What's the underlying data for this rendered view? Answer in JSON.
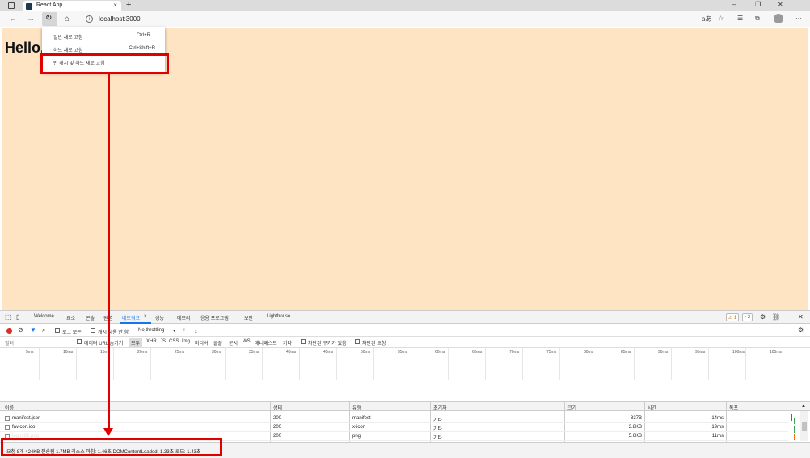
{
  "browser": {
    "tab_title": "React App",
    "tab_close": "×",
    "new_tab": "+",
    "window_controls": [
      "–",
      "❐",
      "✕"
    ],
    "url": "localhost:3000",
    "icons": [
      "back-icon",
      "forward-icon",
      "reload-icon",
      "home-icon",
      "info-icon",
      "read-aloud-icon",
      "favorite-icon",
      "favorites-icon",
      "collections-icon",
      "profile-icon",
      "more-icon"
    ]
  },
  "page": {
    "heading": "Hello,",
    "background": "#ffe4c4"
  },
  "context_menu": {
    "items": [
      {
        "label": "일반 새로 고침",
        "shortcut": "Ctrl+R"
      },
      {
        "label": "하드 새로 고침",
        "shortcut": "Ctrl+Shift+R"
      },
      {
        "label": "빈 캐시 및 하드 새로 고침",
        "shortcut": ""
      }
    ]
  },
  "annotation_color": "#e00000",
  "devtools": {
    "tabs": [
      "Welcome",
      "요소",
      "콘솔",
      "원본",
      "네트워크",
      "성능",
      "메모리",
      "응용 프로그램",
      "보안",
      "Lighthouse"
    ],
    "active_tab": "네트워크",
    "tab_close": "×",
    "warnings": "1",
    "messages": "2",
    "toolbar": {
      "preserve_log": "로그 보존",
      "disable_cache": "캐시 사용 안 함",
      "throttling": "No throttling"
    },
    "filter": {
      "placeholder": "필터",
      "hide_data_urls": "데이터 URL 숨기기",
      "types": [
        "모두",
        "XHR",
        "JS",
        "CSS",
        "Img",
        "미디어",
        "글꼴",
        "문서",
        "WS",
        "매니페스트",
        "기타"
      ],
      "blocked_cookies": "차단된 쿠키가 있음",
      "blocked_requests": "차단된 요청"
    },
    "timeline_ticks": [
      "5ms",
      "10ms",
      "15ms",
      "20ms",
      "25ms",
      "30ms",
      "35ms",
      "40ms",
      "45ms",
      "50ms",
      "55ms",
      "60ms",
      "65ms",
      "70ms",
      "75ms",
      "80ms",
      "85ms",
      "90ms",
      "95ms",
      "100ms",
      "105ms"
    ],
    "columns": [
      "이름",
      "상태",
      "유형",
      "초기자",
      "크기",
      "시간",
      "폭포"
    ],
    "rows": [
      {
        "name": "manifest.json",
        "status": "200",
        "type": "manifest",
        "initiator": "기타",
        "size": "837B",
        "time": "14ms"
      },
      {
        "name": "favicon.ico",
        "status": "200",
        "type": "x-icon",
        "initiator": "기타",
        "size": "3.8KB",
        "time": "19ms"
      },
      {
        "name": "logo192.png",
        "status": "200",
        "type": "png",
        "initiator": "기타",
        "size": "5.6KB",
        "time": "11ms"
      }
    ],
    "status": "요청 8개  424KB 전송됨  1.7MB 리소스  마침: 1.46초  DOMContentLoaded: 1.33초  로드: 1.43초"
  }
}
